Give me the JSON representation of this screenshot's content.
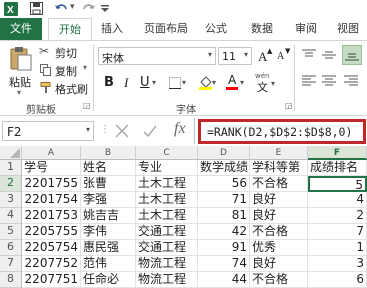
{
  "quick_access": {
    "redo_arrow": "▾"
  },
  "tabs": [
    {
      "label": "文件",
      "active": false,
      "file": true
    },
    {
      "label": "开始",
      "active": true
    },
    {
      "label": "插入",
      "active": false
    },
    {
      "label": "页面布局",
      "active": false
    },
    {
      "label": "公式",
      "active": false
    },
    {
      "label": "数据",
      "active": false
    },
    {
      "label": "审阅",
      "active": false
    },
    {
      "label": "视图",
      "active": false
    }
  ],
  "ribbon": {
    "clipboard": {
      "paste": "粘贴",
      "cut": "剪切",
      "copy": "复制",
      "format_painter": "格式刷",
      "group_label": "剪贴板"
    },
    "font": {
      "font_name": "宋体",
      "font_size": "11",
      "grow": "A",
      "shrink": "A",
      "bold": "B",
      "italic": "I",
      "underline": "U",
      "font_color": "A",
      "wen": "wén",
      "group_label": "字体"
    }
  },
  "formula_bar": {
    "name_box": "F2",
    "fx": "fx",
    "formula": "=RANK(D2,$D$2:$D$8,0)"
  },
  "sheet": {
    "columns": [
      "A",
      "B",
      "C",
      "D",
      "E",
      "F"
    ],
    "rows": [
      {
        "num": "1",
        "cells": [
          "学号",
          "姓名",
          "专业",
          "数学成绩",
          "学科等第",
          "成绩排名"
        ]
      },
      {
        "num": "2",
        "cells": [
          "2201755",
          "张曹",
          "土木工程",
          "56",
          "不合格",
          "5"
        ]
      },
      {
        "num": "3",
        "cells": [
          "2201754",
          "李强",
          "土木工程",
          "71",
          "良好",
          "4"
        ]
      },
      {
        "num": "4",
        "cells": [
          "2201753",
          "姚吉吉",
          "土木工程",
          "81",
          "良好",
          "2"
        ]
      },
      {
        "num": "5",
        "cells": [
          "2205755",
          "李伟",
          "交通工程",
          "42",
          "不合格",
          "7"
        ]
      },
      {
        "num": "6",
        "cells": [
          "2205754",
          "惠民强",
          "交通工程",
          "91",
          "优秀",
          "1"
        ]
      },
      {
        "num": "7",
        "cells": [
          "2207752",
          "范伟",
          "物流工程",
          "74",
          "良好",
          "3"
        ]
      },
      {
        "num": "8",
        "cells": [
          "2207751",
          "任命必",
          "物流工程",
          "44",
          "不合格",
          "6"
        ]
      }
    ]
  },
  "colors": {
    "excel_green": "#217346",
    "highlight_red": "#c0272d",
    "selected_col": "#dbe5d8"
  }
}
